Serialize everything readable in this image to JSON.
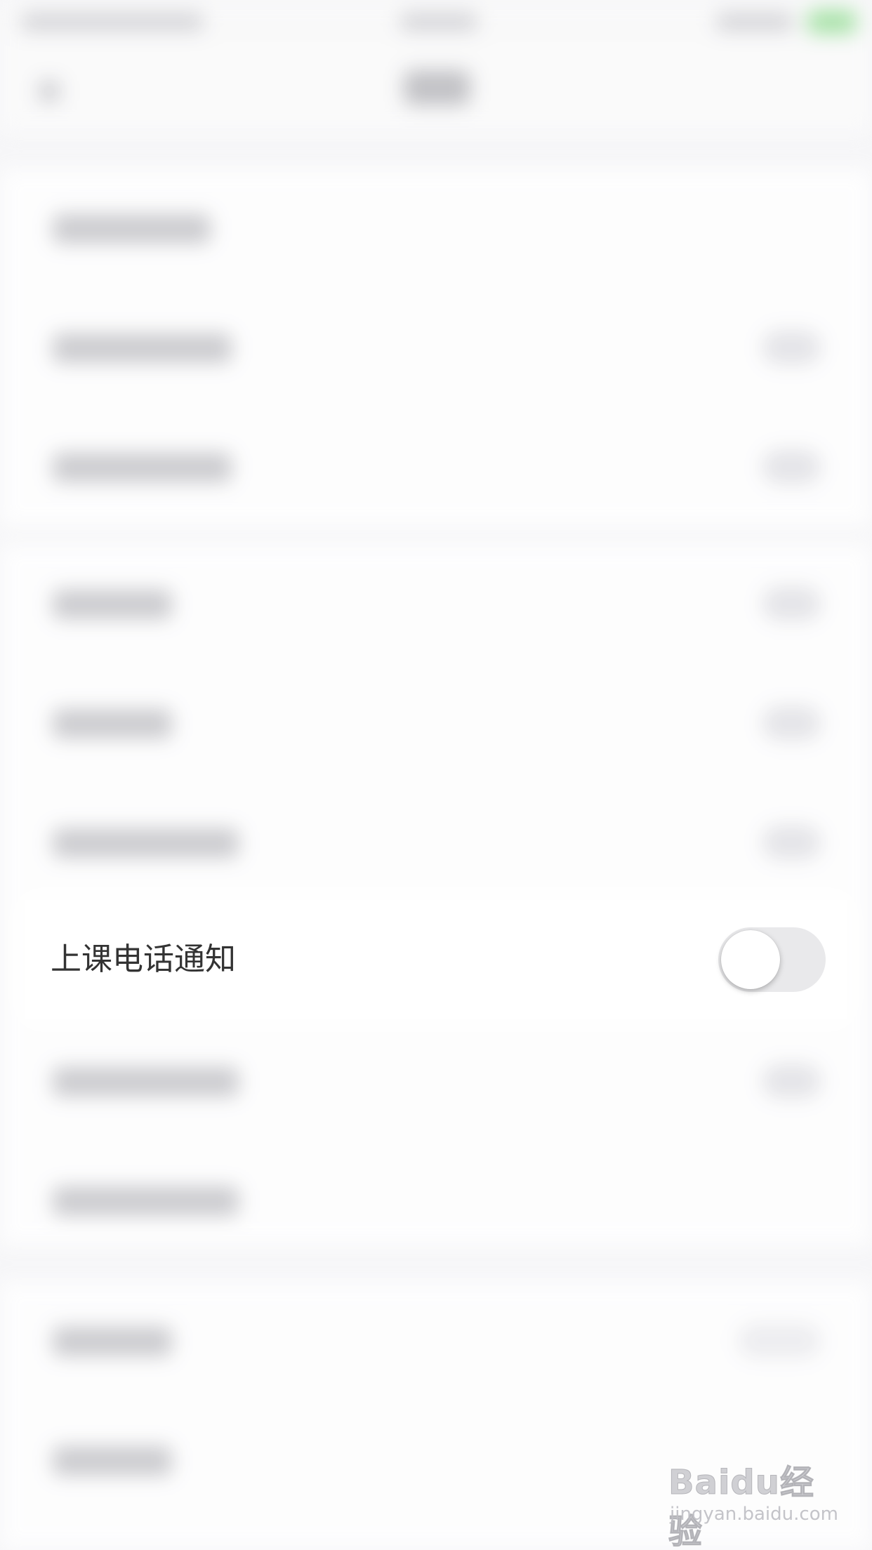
{
  "settings": {
    "focused_row": {
      "label": "上课电话通知",
      "toggle_on": false
    }
  },
  "watermark": {
    "logo": "Baidu经验",
    "url": "jingyan.baidu.com"
  },
  "colors": {
    "toggle_off_track": "#e9e9eb",
    "toggle_knob": "#ffffff",
    "label_text": "#333333",
    "background": "#f6f6f8"
  }
}
